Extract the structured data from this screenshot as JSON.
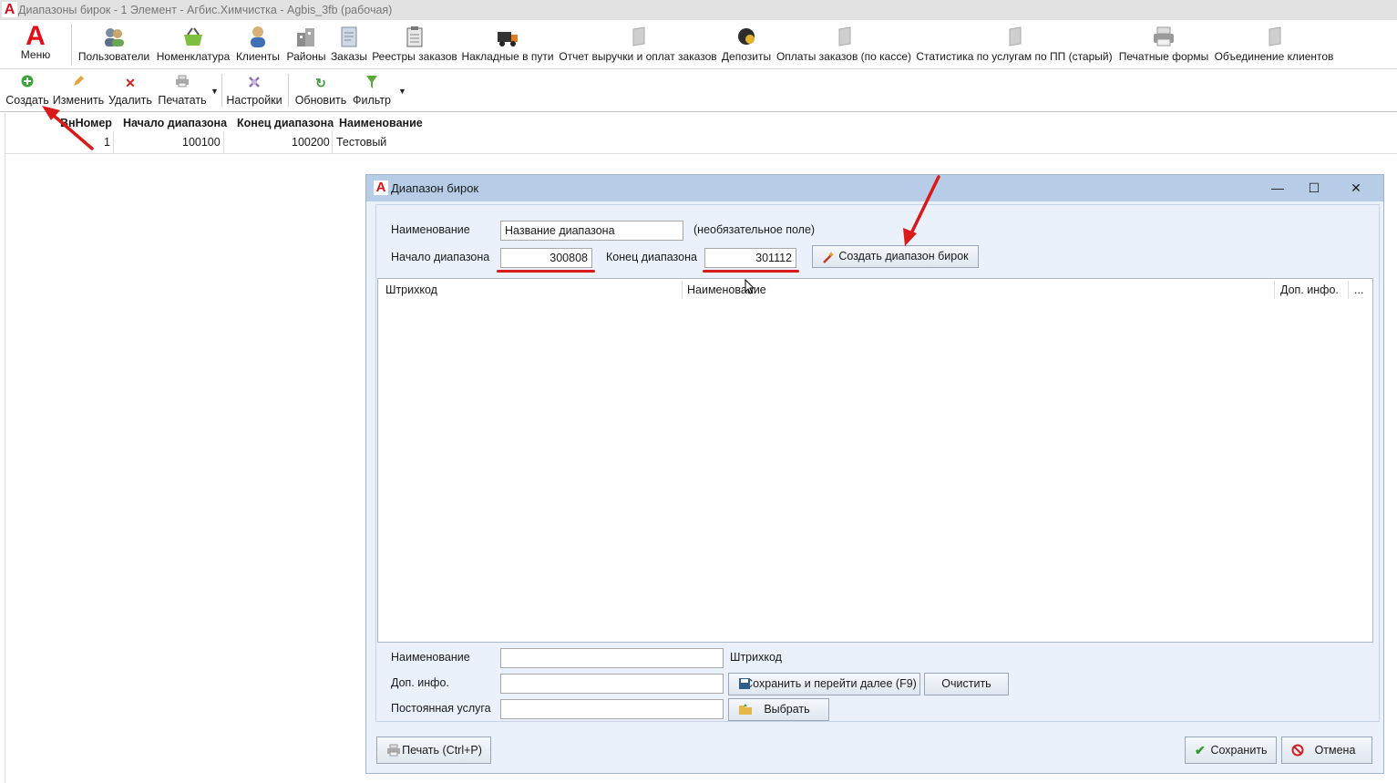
{
  "window": {
    "title": "Диапазоны бирок - 1 Элемент - Агбис.Химчистка - Agbis_3fb (рабочая)"
  },
  "main_toolbar": {
    "menu_label": "Меню",
    "items": [
      "Пользователи",
      "Номенклатура",
      "Клиенты",
      "Районы",
      "Заказы",
      "Реестры заказов",
      "Накладные в пути",
      "Отчет выручки и оплат заказов",
      "Депозиты",
      "Оплаты заказов (по кассе)",
      "Статистика по услугам по ПП (старый)",
      "Печатные формы",
      "Объединение клиентов"
    ]
  },
  "action_toolbar": {
    "create": "Создать",
    "edit": "Изменить",
    "delete": "Удалить",
    "print": "Печатать",
    "settings": "Настройки",
    "refresh": "Обновить",
    "filter": "Фильтр"
  },
  "grid": {
    "columns": [
      "ВнНомер",
      "Начало диапазона",
      "Конец диапазона",
      "Наименование"
    ],
    "rows": [
      {
        "id": "1",
        "start": "100100",
        "end": "100200",
        "name": "Тестовый"
      }
    ]
  },
  "dialog": {
    "title": "Диапазон бирок",
    "name_label": "Наименование",
    "name_value": "Название диапазона",
    "optional_note": "(необязательное поле)",
    "start_label": "Начало диапазона",
    "start_value": "300808",
    "end_label": "Конец диапазона",
    "end_value": "301112",
    "create_range_button": "Создать диапазон бирок",
    "list_columns": [
      "Штрихкод",
      "Наименование",
      "Доп. инфо.",
      "..."
    ],
    "bottom": {
      "name_label": "Наименование",
      "barcode_label": "Штрихкод",
      "extra_label": "Доп. инфо.",
      "service_label": "Постоянная услуга",
      "save_next_button": "Сохранить и перейти далее (F9)",
      "clear_button": "Очистить",
      "choose_button": "Выбрать"
    },
    "print_button": "Печать (Ctrl+P)",
    "save_button": "Сохранить",
    "cancel_button": "Отмена"
  },
  "colors": {
    "brand_red": "#e0101a",
    "annotation_red": "#d91a1a",
    "dialog_bg": "#eaf1fb",
    "dialog_title_bg": "#b7cde7"
  }
}
